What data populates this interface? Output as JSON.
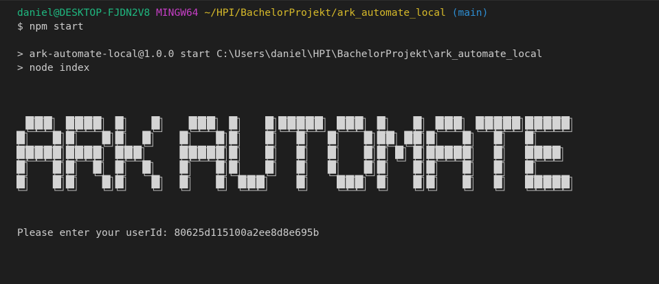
{
  "prompt": {
    "user_host": "daniel@DESKTOP-FJDN2V8",
    "shell": "MINGW64",
    "path": "~/HPI/BachelorProjekt/ark_automate_local",
    "branch": "(main)",
    "symbol": "$",
    "command": "npm start"
  },
  "output": {
    "line1": "> ark-automate-local@1.0.0 start C:\\Users\\daniel\\HPI\\BachelorProjekt\\ark_automate_local",
    "line2": "> node index",
    "banner": "ARK AUTOMATE",
    "user_prompt": "Please enter your userId: 80625d115100a2ee8d8e695b"
  },
  "colors": {
    "background": "#1e1e1e",
    "text": "#cccccc",
    "user_host": "#1fb880",
    "shell": "#c63fc6",
    "path": "#d7ba2a",
    "branch": "#2e8fd4",
    "banner_fill": "#d4d4d4",
    "banner_outline": "#bdbdbd"
  }
}
